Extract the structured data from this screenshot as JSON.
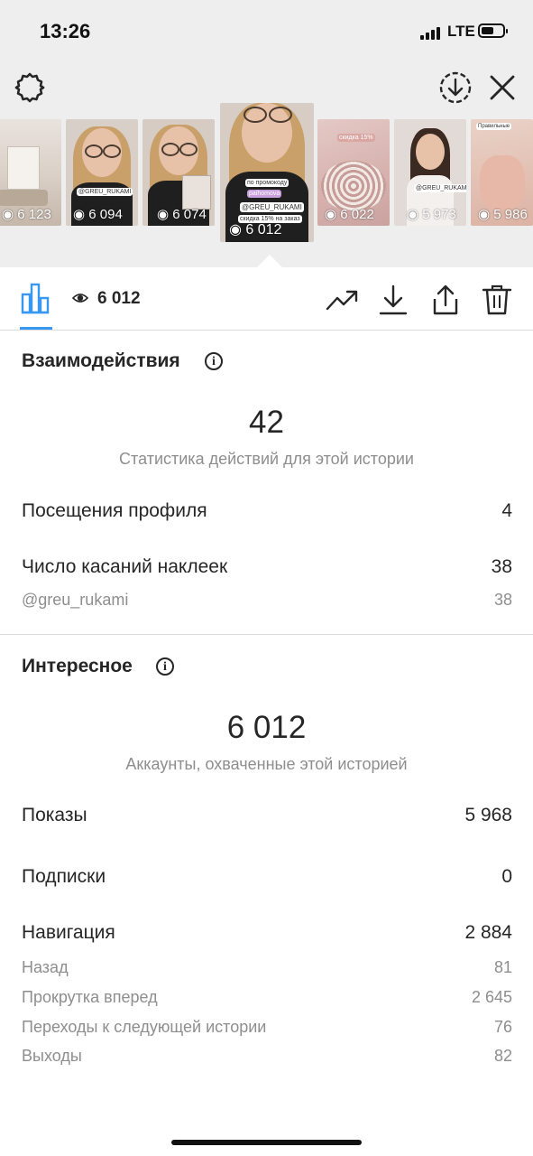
{
  "status_bar": {
    "time": "13:26",
    "network": "LTE"
  },
  "stories": [
    {
      "count": "6 123"
    },
    {
      "count": "6 094"
    },
    {
      "count": "6 074"
    },
    {
      "count": "6 012",
      "selected": true
    },
    {
      "count": "6 022"
    },
    {
      "count": "5 973"
    },
    {
      "count": "5 986"
    }
  ],
  "toolbar": {
    "views": "6 012"
  },
  "interactions": {
    "title": "Взаимодействия",
    "total": "42",
    "caption": "Статистика действий для этой истории",
    "rows": [
      {
        "label": "Посещения профиля",
        "value": "4"
      },
      {
        "label": "Число касаний наклеек",
        "value": "38"
      }
    ],
    "sub_rows": [
      {
        "label": "@greu_rukami",
        "value": "38"
      }
    ]
  },
  "discovery": {
    "title": "Интересное",
    "total": "6 012",
    "caption": "Аккаунты, охваченные этой историей",
    "rows": [
      {
        "label": "Показы",
        "value": "5 968"
      },
      {
        "label": "Подписки",
        "value": "0"
      },
      {
        "label": "Навигация",
        "value": "2 884"
      }
    ],
    "sub_rows": [
      {
        "label": "Назад",
        "value": "81"
      },
      {
        "label": "Прокрутка вперед",
        "value": "2 645"
      },
      {
        "label": "Переходы к следующей истории",
        "value": "76"
      },
      {
        "label": "Выходы",
        "value": "82"
      }
    ]
  },
  "colors": {
    "accent": "#3897f0",
    "text": "#262626",
    "muted": "#8e8e8e",
    "divider": "#dbdbdb",
    "header_bg": "#eeeeee"
  }
}
